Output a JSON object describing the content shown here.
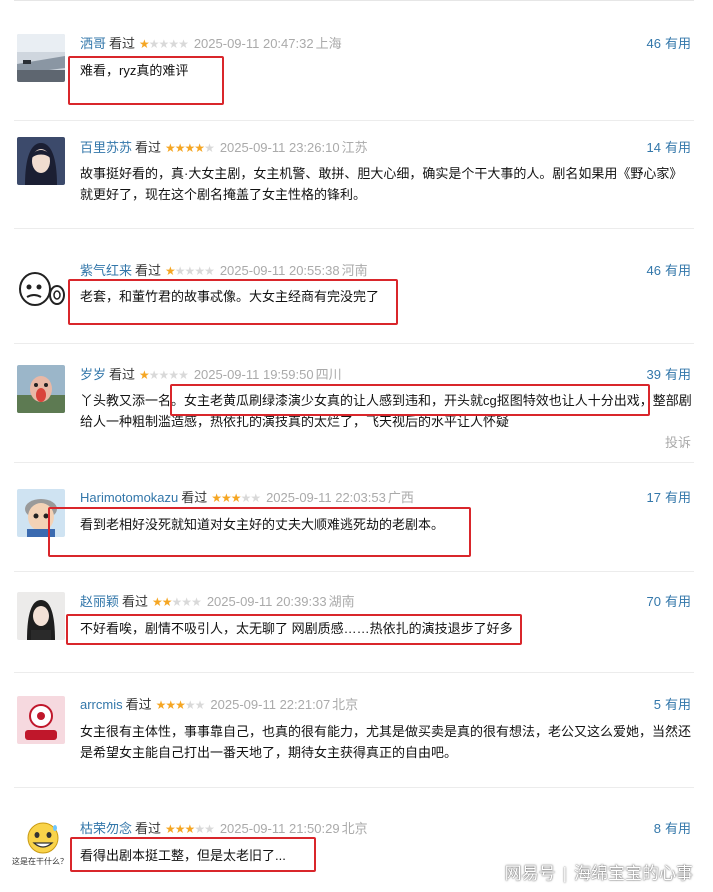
{
  "comments": [
    {
      "user": "洒哥",
      "watched": "看过",
      "rating": 1,
      "time": "2025-09-11 20:47:32",
      "location": "上海",
      "useful_count": "46",
      "useful_label": "有用",
      "text": "难看，ryz真的难评"
    },
    {
      "user": "百里苏苏",
      "watched": "看过",
      "rating": 4,
      "time": "2025-09-11 23:26:10",
      "location": "江苏",
      "useful_count": "14",
      "useful_label": "有用",
      "text": "故事挺好看的，真·大女主剧，女主机警、敢拼、胆大心细，确实是个干大事的人。剧名如果用《野心家》就更好了，现在这个剧名掩盖了女主性格的锋利。"
    },
    {
      "user": "紫气红来",
      "watched": "看过",
      "rating": 1,
      "time": "2025-09-11 20:55:38",
      "location": "河南",
      "useful_count": "46",
      "useful_label": "有用",
      "text": "老套，和董竹君的故事忒像。大女主经商有完没完了"
    },
    {
      "user": "岁岁",
      "watched": "看过",
      "rating": 1,
      "time": "2025-09-11 19:59:50",
      "location": "四川",
      "useful_count": "39",
      "useful_label": "有用",
      "text": "丫头教又添一名。女主老黄瓜刷绿漆演少女真的让人感到违和，开头就cg抠图特效也让人十分出戏，整部剧给人一种粗制滥造感，热依扎的演技真的太烂了，飞天视后的水平让人怀疑",
      "report": "投诉"
    },
    {
      "user": "Harimotomokazu",
      "watched": "看过",
      "rating": 3,
      "time": "2025-09-11 22:03:53",
      "location": "广西",
      "useful_count": "17",
      "useful_label": "有用",
      "text": "看到老相好没死就知道对女主好的丈夫大顺难逃死劫的老剧本。"
    },
    {
      "user": "赵丽颖",
      "watched": "看过",
      "rating": 2,
      "time": "2025-09-11 20:39:33",
      "location": "湖南",
      "useful_count": "70",
      "useful_label": "有用",
      "text": "不好看唉，剧情不吸引人，太无聊了 网剧质感……热依扎的演技退步了好多"
    },
    {
      "user": "arrcmis",
      "watched": "看过",
      "rating": 3,
      "time": "2025-09-11 22:21:07",
      "location": "北京",
      "useful_count": "5",
      "useful_label": "有用",
      "text": "女主很有主体性，事事靠自己，也真的很有能力，尤其是做买卖是真的很有想法，老公又这么爱她，当然还是希望女主能自己打出一番天地了，期待女主获得真正的自由吧。"
    },
    {
      "user": "枯荣勿念",
      "watched": "看过",
      "rating": 3,
      "time": "2025-09-11 21:50:29",
      "location": "北京",
      "useful_count": "8",
      "useful_label": "有用",
      "text": "看得出剧本挺工整，但是太老旧了...",
      "avatar_caption": "这是在干什么？"
    }
  ],
  "watermark": {
    "platform": "网易号",
    "author": "海绵宝宝的心事"
  },
  "colors": {
    "username": "#3377aa",
    "star": "#f5a623",
    "highlight_box": "#d9262b",
    "meta_gray": "#aaaaaa"
  },
  "icons": [
    "star-icon"
  ]
}
